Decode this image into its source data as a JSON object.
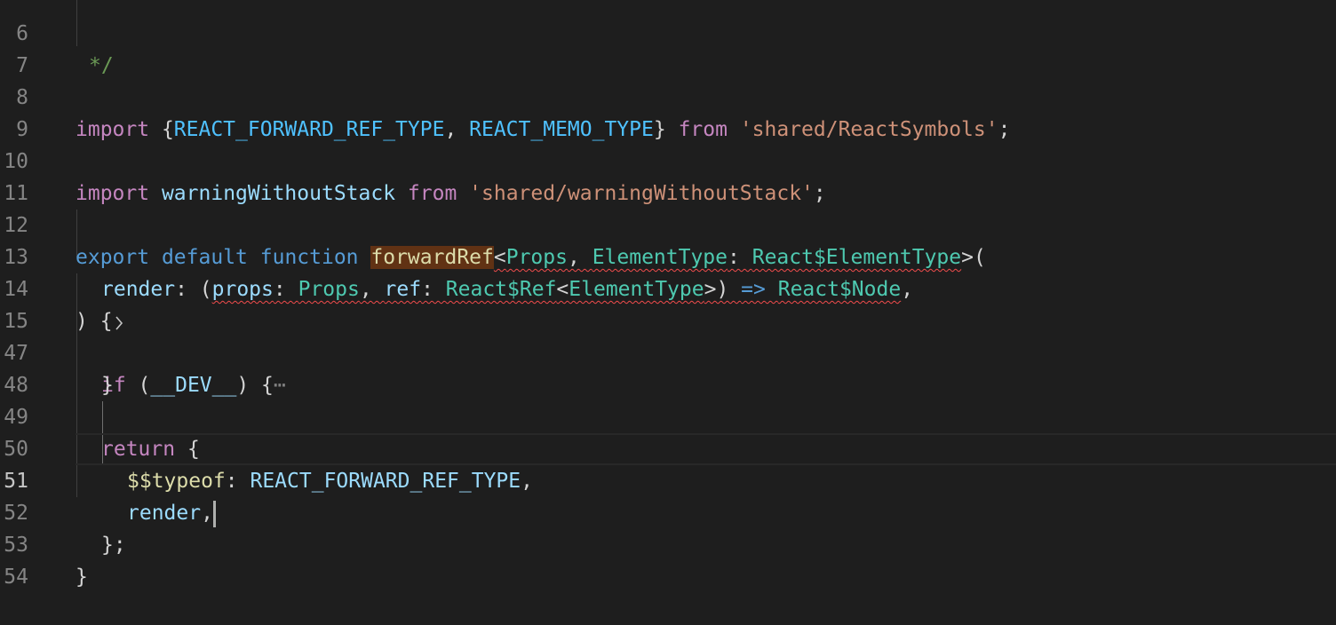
{
  "gutter": {
    "line_numbers": [
      "6",
      "7",
      "8",
      "9",
      "10",
      "11",
      "12",
      "13",
      "14",
      "15",
      "47",
      "48",
      "49",
      "50",
      "51",
      "52",
      "53",
      "54"
    ],
    "active_line": "51"
  },
  "code": {
    "l6": {
      "comment": "*/"
    },
    "l8": {
      "import_kw": "import",
      "open_brace": " {",
      "c1": "REACT_FORWARD_REF_TYPE",
      "comma": ", ",
      "c2": "REACT_MEMO_TYPE",
      "close_brace": "} ",
      "from_kw": "from",
      "space": " ",
      "source": "'shared/ReactSymbols'",
      "semi": ";"
    },
    "l10": {
      "import_kw": "import",
      "space1": " ",
      "name": "warningWithoutStack",
      "space2": " ",
      "from_kw": "from",
      "space3": " ",
      "source": "'shared/warningWithoutStack'",
      "semi": ";"
    },
    "l12": {
      "export_kw": "export",
      "s1": " ",
      "default_kw": "default",
      "s2": " ",
      "function_kw": "function",
      "s3": " ",
      "fn_name": "forwardRef",
      "lt": "<",
      "t1": "Props",
      "comma": ", ",
      "t2": "ElementType",
      "colon": ": ",
      "t3": "React$ElementType",
      "gt_paren": ">("
    },
    "l13": {
      "param": "render",
      "colon1": ": (",
      "p1": "props",
      "colon2": ": ",
      "t1": "Props",
      "comma": ", ",
      "p2": "ref",
      "colon3": ": ",
      "t2": "React$Ref",
      "lt": "<",
      "t3": "ElementType",
      "gt_paren": ">) ",
      "arrow": "=>",
      "space": " ",
      "t4": "React$Node",
      "trail": ","
    },
    "l14": {
      "text": ") {"
    },
    "l15": {
      "if_kw": "if",
      "open": " (",
      "dev": "__DEV__",
      "close": ") {",
      "ellipsis": "⋯"
    },
    "l47": {
      "text": "}"
    },
    "l49": {
      "return_kw": "return",
      "brace": " {"
    },
    "l50": {
      "key": "$$typeof",
      "colon": ": ",
      "val": "REACT_FORWARD_REF_TYPE",
      "comma": ","
    },
    "l51": {
      "key": "render",
      "comma": ","
    },
    "l52": {
      "text": "};"
    },
    "l53": {
      "text": "}"
    }
  },
  "icons": {
    "fold": "chevron-right-icon"
  }
}
